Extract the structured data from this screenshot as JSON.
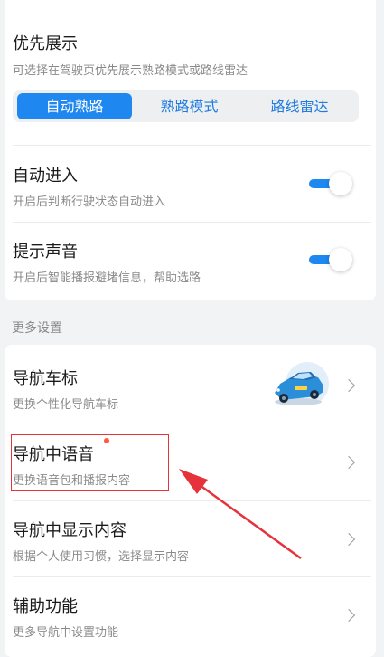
{
  "priority": {
    "title": "优先展示",
    "subtitle": "可选择在驾驶页优先展示熟路模式或路线雷达",
    "options": [
      "自动熟路",
      "熟路模式",
      "路线雷达"
    ],
    "selected": "自动熟路"
  },
  "auto_enter": {
    "title": "自动进入",
    "subtitle": "开启后判断行驶状态自动进入",
    "enabled": true
  },
  "sound": {
    "title": "提示声音",
    "subtitle": "开启后智能播报避堵信息，帮助选路",
    "enabled": true
  },
  "more_settings_label": "更多设置",
  "rows": [
    {
      "title": "导航车标",
      "subtitle": "更换个性化导航车标",
      "icon": "car-icon"
    },
    {
      "title": "导航中语音",
      "subtitle": "更换语音包和播报内容",
      "has_badge": true
    },
    {
      "title": "导航中显示内容",
      "subtitle": "根据个人使用习惯，选择显示内容"
    },
    {
      "title": "辅助功能",
      "subtitle": "更多导航中设置功能"
    }
  ],
  "colors": {
    "accent": "#1e87f0",
    "badge": "#ff5a3c",
    "annotation": "#e5323b"
  }
}
